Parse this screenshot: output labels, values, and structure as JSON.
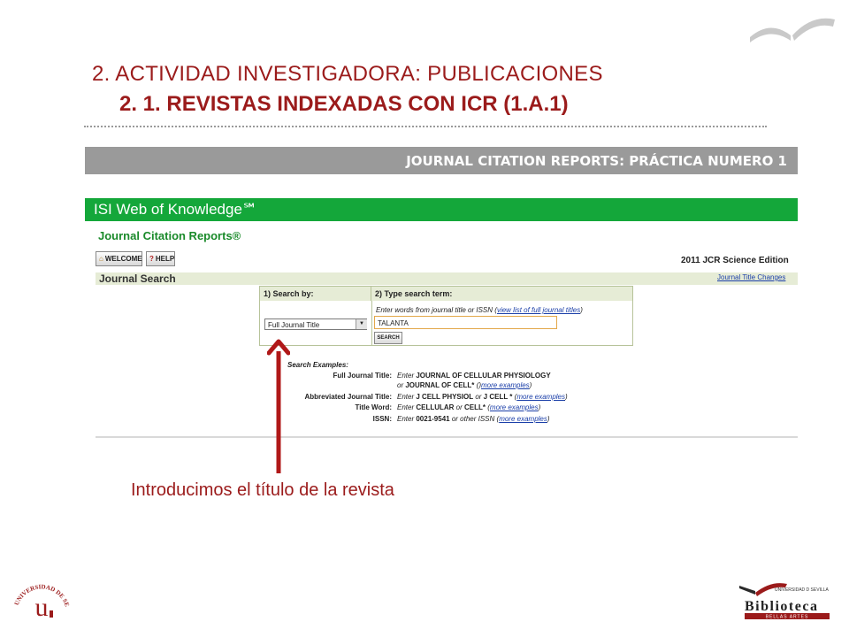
{
  "slide": {
    "heading1": "2. ACTIVIDAD INVESTIGADORA: PUBLICACIONES",
    "heading2": "2. 1. REVISTAS INDEXADAS CON ICR (1.A.1)",
    "section_bar": "JOURNAL CITATION REPORTS: PRÁCTICA NUMERO 1",
    "caption": "Introducimos el título de la revista"
  },
  "isi": {
    "brand": "ISI Web of Knowledge℠",
    "product": "Journal Citation Reports®",
    "welcome_label": "WELCOME",
    "help_label": "HELP",
    "edition": "2011 JCR Science Edition",
    "section_title": "Journal Search",
    "title_changes_link": "Journal Title Changes",
    "step1_header": "1) Search by:",
    "step2_header": "2) Type search term:",
    "search_by_value": "Full Journal Title",
    "instruction_prefix": "Enter words from journal title or ISSN (",
    "instruction_link": "view list of full journal titles",
    "instruction_suffix": ")",
    "search_term_value": "TALANTA",
    "search_button": "SEARCH",
    "examples_title": "Search Examples:",
    "examples": [
      {
        "label": "Full Journal Title:",
        "pre": "Enter ",
        "b1": "JOURNAL OF CELLULAR PHYSIOLOGY",
        "mid": "",
        "b2": "",
        "post": "",
        "link": ""
      },
      {
        "label": "",
        "pre": "or ",
        "b1": "JOURNAL OF CELL*",
        "mid": " (",
        "b2": "",
        "post": ")",
        "link": "more examples"
      },
      {
        "label": "Abbreviated Journal Title:",
        "pre": "Enter ",
        "b1": "J CELL PHYSIOL",
        "mid": " or ",
        "b2": "J CELL *",
        "post": " (",
        "link": "more examples"
      },
      {
        "label": "Title Word:",
        "pre": "Enter ",
        "b1": "CELLULAR",
        "mid": " or ",
        "b2": "CELL*",
        "post": " (",
        "link": "more examples"
      },
      {
        "label": "ISSN:",
        "pre": "Enter ",
        "b1": "0021-9541",
        "mid": " or other ISSN (",
        "b2": "",
        "post": "",
        "link": "more examples"
      }
    ],
    "close_paren": ")"
  },
  "logos": {
    "university_text": "UNIVERSIDAD DE SEVILLA",
    "library_top": "UNIVERSIDAD D SEVILLA",
    "library_name": "Biblioteca",
    "library_sub": "BELLAS ARTES"
  },
  "colors": {
    "accent_red": "#9b1b1b",
    "isi_green": "#14a73a",
    "bar_gray": "#9a9a9a"
  }
}
